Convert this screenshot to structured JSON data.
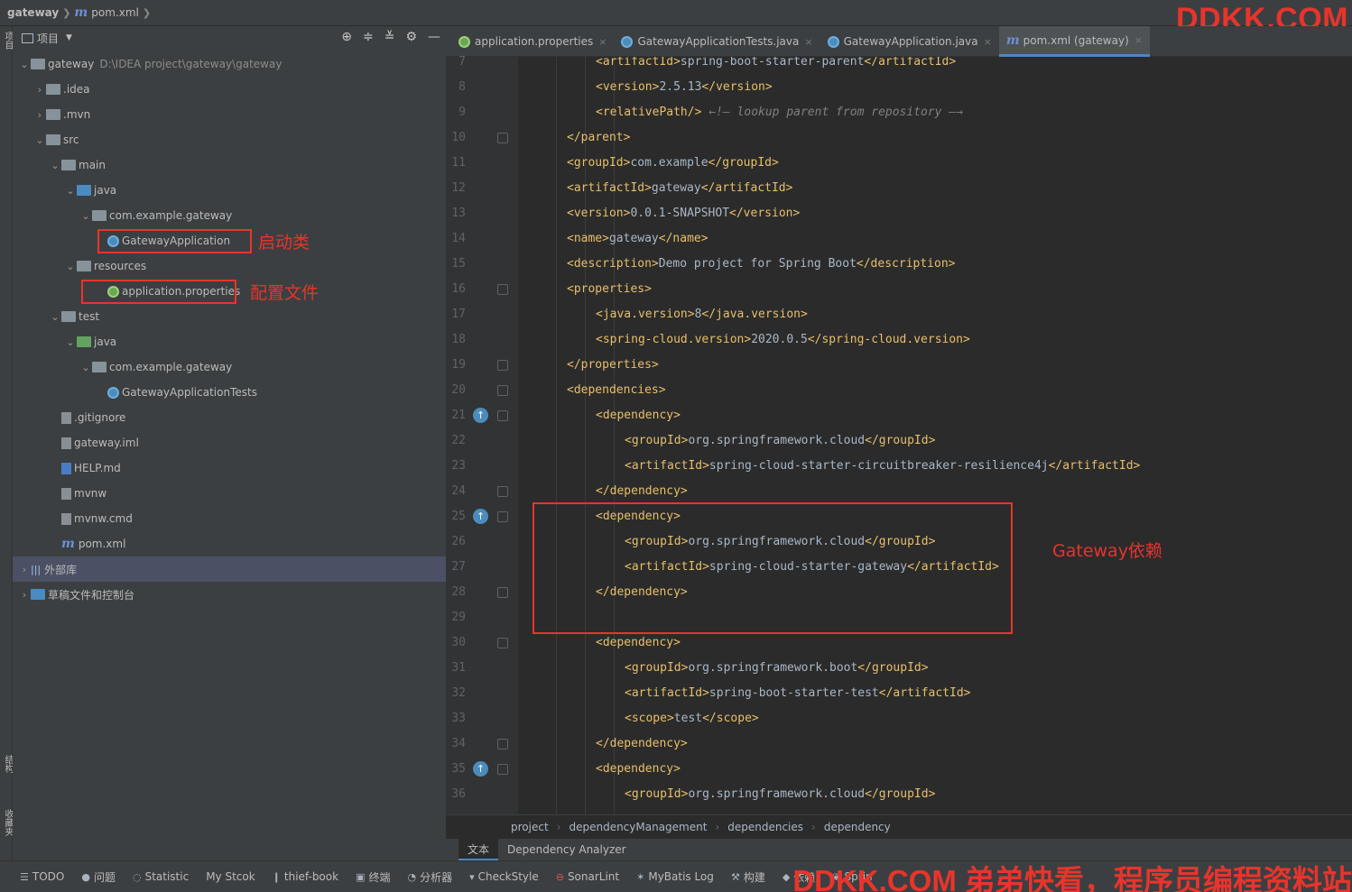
{
  "breadcrumb": {
    "project": "gateway",
    "file": "pom.xml"
  },
  "watermark_top": "DDKK.COM",
  "watermark_bottom": "DDKK.COM 弟弟快看，程序员编程资料站",
  "left_stripe": {
    "project_label": "项目",
    "structure_label": "结构",
    "favorites_label": "收藏夹"
  },
  "project_panel": {
    "title": "项目",
    "tree": [
      {
        "label": "gateway",
        "path": "D:\\IDEA project\\gateway\\gateway",
        "depth": 0,
        "arrow": "v",
        "icon": "folder"
      },
      {
        "label": ".idea",
        "depth": 1,
        "arrow": ">",
        "icon": "folder"
      },
      {
        "label": ".mvn",
        "depth": 1,
        "arrow": ">",
        "icon": "folder"
      },
      {
        "label": "src",
        "depth": 1,
        "arrow": "v",
        "icon": "folder"
      },
      {
        "label": "main",
        "depth": 2,
        "arrow": "v",
        "icon": "folder"
      },
      {
        "label": "java",
        "depth": 3,
        "arrow": "v",
        "icon": "folder-blue"
      },
      {
        "label": "com.example.gateway",
        "depth": 4,
        "arrow": "v",
        "icon": "folder"
      },
      {
        "label": "GatewayApplication",
        "depth": 5,
        "arrow": "",
        "icon": "spring"
      },
      {
        "label": "resources",
        "depth": 3,
        "arrow": "v",
        "icon": "folder"
      },
      {
        "label": "application.properties",
        "depth": 5,
        "arrow": "",
        "icon": "spring-green"
      },
      {
        "label": "test",
        "depth": 2,
        "arrow": "v",
        "icon": "folder"
      },
      {
        "label": "java",
        "depth": 3,
        "arrow": "v",
        "icon": "folder-green"
      },
      {
        "label": "com.example.gateway",
        "depth": 4,
        "arrow": "v",
        "icon": "folder"
      },
      {
        "label": "GatewayApplicationTests",
        "depth": 5,
        "arrow": "",
        "icon": "spring"
      },
      {
        "label": ".gitignore",
        "depth": 2,
        "arrow": "",
        "icon": "file"
      },
      {
        "label": "gateway.iml",
        "depth": 2,
        "arrow": "",
        "icon": "file"
      },
      {
        "label": "HELP.md",
        "depth": 2,
        "arrow": "",
        "icon": "md"
      },
      {
        "label": "mvnw",
        "depth": 2,
        "arrow": "",
        "icon": "file"
      },
      {
        "label": "mvnw.cmd",
        "depth": 2,
        "arrow": "",
        "icon": "file"
      },
      {
        "label": "pom.xml",
        "depth": 2,
        "arrow": "",
        "icon": "maven"
      },
      {
        "label": "外部库",
        "depth": 0,
        "arrow": ">",
        "icon": "lib",
        "selected": true
      },
      {
        "label": "草稿文件和控制台",
        "depth": 0,
        "arrow": ">",
        "icon": "scratch"
      }
    ]
  },
  "annotations": {
    "startup_class": "启动类",
    "config_file": "配置文件",
    "gateway_dependency": "Gateway依赖"
  },
  "tabs": [
    {
      "label": "application.properties",
      "icon": "spring-green",
      "active": false,
      "closable": true
    },
    {
      "label": "GatewayApplicationTests.java",
      "icon": "spring",
      "active": false,
      "closable": true
    },
    {
      "label": "GatewayApplication.java",
      "icon": "spring",
      "active": false,
      "closable": true
    },
    {
      "label": "pom.xml (gateway)",
      "icon": "maven",
      "active": true,
      "closable": true
    }
  ],
  "code_lines": [
    {
      "n": "7",
      "indent": 2,
      "parts": [
        [
          "tag",
          "<artifactId>"
        ],
        [
          "txt",
          "spring-boot-starter-parent"
        ],
        [
          "tag",
          "</artifactId>"
        ]
      ]
    },
    {
      "n": "8",
      "indent": 2,
      "parts": [
        [
          "tag",
          "<version>"
        ],
        [
          "txt",
          "2.5.13"
        ],
        [
          "tag",
          "</version>"
        ]
      ]
    },
    {
      "n": "9",
      "indent": 2,
      "parts": [
        [
          "tag",
          "<relativePath/>"
        ],
        [
          "cmt",
          " ←!— lookup parent from repository —→"
        ]
      ]
    },
    {
      "n": "10",
      "indent": 1,
      "mark": true,
      "parts": [
        [
          "tag",
          "</parent>"
        ]
      ]
    },
    {
      "n": "11",
      "indent": 1,
      "parts": [
        [
          "tag",
          "<groupId>"
        ],
        [
          "txt",
          "com.example"
        ],
        [
          "tag",
          "</groupId>"
        ]
      ]
    },
    {
      "n": "12",
      "indent": 1,
      "parts": [
        [
          "tag",
          "<artifactId>"
        ],
        [
          "txt",
          "gateway"
        ],
        [
          "tag",
          "</artifactId>"
        ]
      ]
    },
    {
      "n": "13",
      "indent": 1,
      "parts": [
        [
          "tag",
          "<version>"
        ],
        [
          "txt",
          "0.0.1-SNAPSHOT"
        ],
        [
          "tag",
          "</version>"
        ]
      ]
    },
    {
      "n": "14",
      "indent": 1,
      "parts": [
        [
          "tag",
          "<name>"
        ],
        [
          "txt",
          "gateway"
        ],
        [
          "tag",
          "</name>"
        ]
      ]
    },
    {
      "n": "15",
      "indent": 1,
      "parts": [
        [
          "tag",
          "<description>"
        ],
        [
          "txt",
          "Demo project for Spring Boot"
        ],
        [
          "tag",
          "</description>"
        ]
      ]
    },
    {
      "n": "16",
      "indent": 1,
      "mark": true,
      "parts": [
        [
          "tag",
          "<properties>"
        ]
      ]
    },
    {
      "n": "17",
      "indent": 2,
      "parts": [
        [
          "tag",
          "<java.version>"
        ],
        [
          "txt",
          "8"
        ],
        [
          "tag",
          "</java.version>"
        ]
      ]
    },
    {
      "n": "18",
      "indent": 2,
      "parts": [
        [
          "tag",
          "<spring-cloud.version>"
        ],
        [
          "txt",
          "2020.0.5"
        ],
        [
          "tag",
          "</spring-cloud.version>"
        ]
      ]
    },
    {
      "n": "19",
      "indent": 1,
      "mark": true,
      "parts": [
        [
          "tag",
          "</properties>"
        ]
      ]
    },
    {
      "n": "20",
      "indent": 1,
      "mark": true,
      "parts": [
        [
          "tag",
          "<dependencies>"
        ]
      ]
    },
    {
      "n": "21",
      "indent": 2,
      "mark": true,
      "run": true,
      "parts": [
        [
          "tag",
          "<dependency>"
        ]
      ]
    },
    {
      "n": "22",
      "indent": 3,
      "parts": [
        [
          "tag",
          "<groupId>"
        ],
        [
          "txt",
          "org.springframework.cloud"
        ],
        [
          "tag",
          "</groupId>"
        ]
      ]
    },
    {
      "n": "23",
      "indent": 3,
      "parts": [
        [
          "tag",
          "<artifactId>"
        ],
        [
          "txt",
          "spring-cloud-starter-circuitbreaker-resilience4j"
        ],
        [
          "tag",
          "</artifactId>"
        ]
      ]
    },
    {
      "n": "24",
      "indent": 2,
      "mark": true,
      "parts": [
        [
          "tag",
          "</dependency>"
        ]
      ]
    },
    {
      "n": "25",
      "indent": 2,
      "mark": true,
      "run": true,
      "parts": [
        [
          "tag",
          "<dependency>"
        ]
      ]
    },
    {
      "n": "26",
      "indent": 3,
      "parts": [
        [
          "tag",
          "<groupId>"
        ],
        [
          "txt",
          "org.springframework.cloud"
        ],
        [
          "tag",
          "</groupId>"
        ]
      ]
    },
    {
      "n": "27",
      "indent": 3,
      "parts": [
        [
          "tag",
          "<artifactId>"
        ],
        [
          "txt",
          "spring-cloud-starter-gateway"
        ],
        [
          "tag",
          "</artifactId>"
        ]
      ]
    },
    {
      "n": "28",
      "indent": 2,
      "mark": true,
      "parts": [
        [
          "tag",
          "</dependency>"
        ]
      ]
    },
    {
      "n": "29",
      "indent": 0,
      "parts": []
    },
    {
      "n": "30",
      "indent": 2,
      "mark": true,
      "parts": [
        [
          "tag",
          "<dependency>"
        ]
      ]
    },
    {
      "n": "31",
      "indent": 3,
      "parts": [
        [
          "tag",
          "<groupId>"
        ],
        [
          "txt",
          "org.springframework.boot"
        ],
        [
          "tag",
          "</groupId>"
        ]
      ]
    },
    {
      "n": "32",
      "indent": 3,
      "parts": [
        [
          "tag",
          "<artifactId>"
        ],
        [
          "txt",
          "spring-boot-starter-test"
        ],
        [
          "tag",
          "</artifactId>"
        ]
      ]
    },
    {
      "n": "33",
      "indent": 3,
      "parts": [
        [
          "tag",
          "<scope>"
        ],
        [
          "txt",
          "test"
        ],
        [
          "tag",
          "</scope>"
        ]
      ]
    },
    {
      "n": "34",
      "indent": 2,
      "mark": true,
      "parts": [
        [
          "tag",
          "</dependency>"
        ]
      ]
    },
    {
      "n": "35",
      "indent": 2,
      "mark": true,
      "run": true,
      "parts": [
        [
          "tag",
          "<dependency>"
        ]
      ]
    },
    {
      "n": "36",
      "indent": 3,
      "parts": [
        [
          "tag",
          "<groupId>"
        ],
        [
          "txt",
          "org.springframework.cloud"
        ],
        [
          "tag",
          "</groupId>"
        ]
      ]
    }
  ],
  "editor_breadcrumb": [
    "project",
    "dependencyManagement",
    "dependencies",
    "dependency"
  ],
  "editor_subtabs": {
    "text": "文本",
    "analyzer": "Dependency Analyzer"
  },
  "bottom_bar": [
    {
      "label": "TODO",
      "icon": "list-icon"
    },
    {
      "label": "问题",
      "icon": "info-icon"
    },
    {
      "label": "Statistic",
      "icon": "refresh-icon"
    },
    {
      "label": "My Stcok",
      "icon": ""
    },
    {
      "label": "thief-book",
      "icon": "book-icon"
    },
    {
      "label": "终端",
      "icon": "terminal-icon"
    },
    {
      "label": "分析器",
      "icon": "profiler-icon"
    },
    {
      "label": "CheckStyle",
      "icon": "checkstyle-icon"
    },
    {
      "label": "SonarLint",
      "icon": "sonarlint-icon"
    },
    {
      "label": "MyBatis Log",
      "icon": "mybatis-icon"
    },
    {
      "label": "构建",
      "icon": "hammer-icon"
    },
    {
      "label": "依赖",
      "icon": "dependency-icon"
    },
    {
      "label": "Sprin",
      "icon": "spring-icon"
    }
  ]
}
